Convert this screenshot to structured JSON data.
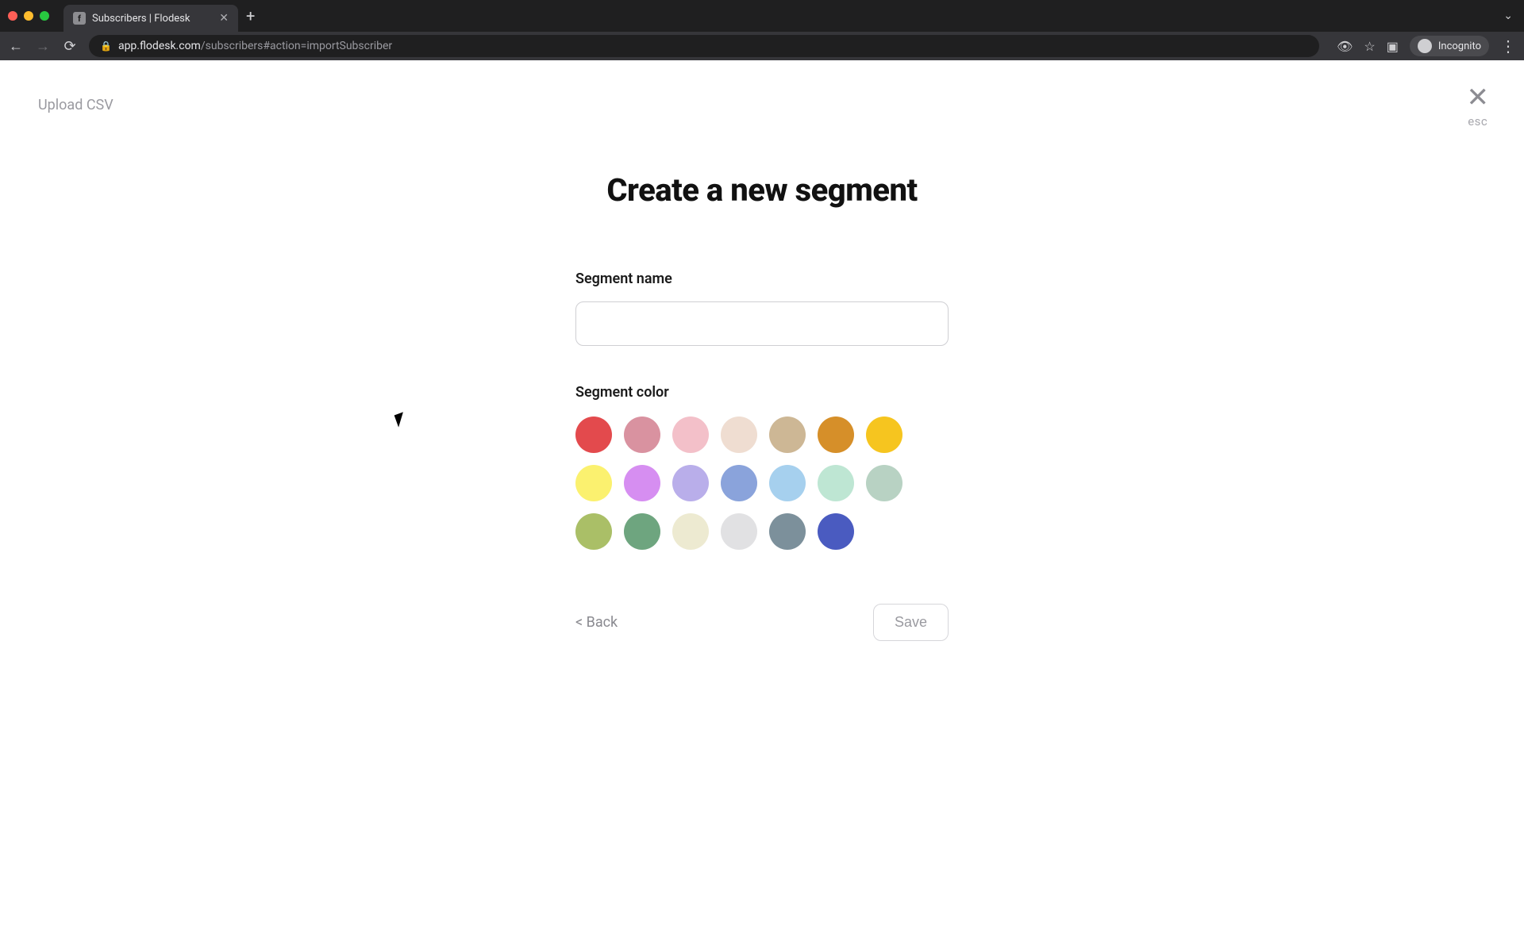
{
  "browser": {
    "tab_title": "Subscribers | Flodesk",
    "url_host": "app.flodesk.com",
    "url_path": "/subscribers#action=importSubscriber",
    "incognito_label": "Incognito"
  },
  "header": {
    "context_label": "Upload CSV",
    "close_label": "esc"
  },
  "page": {
    "title": "Create a new segment",
    "name_label": "Segment name",
    "name_value": "",
    "color_label": "Segment color"
  },
  "colors": [
    "#e34a4d",
    "#d992a0",
    "#f3c0c9",
    "#efddd1",
    "#cdb795",
    "#d68f29",
    "#f6c51f",
    "#fbf16f",
    "#d68ef1",
    "#b9aeea",
    "#8aa3db",
    "#a6d0ee",
    "#bee6d3",
    "#b8d2c3",
    "#aabf67",
    "#6ea57f",
    "#edead1",
    "#e1e1e3",
    "#7c909b",
    "#4a5bc0"
  ],
  "footer": {
    "back_label": "< Back",
    "save_label": "Save"
  }
}
